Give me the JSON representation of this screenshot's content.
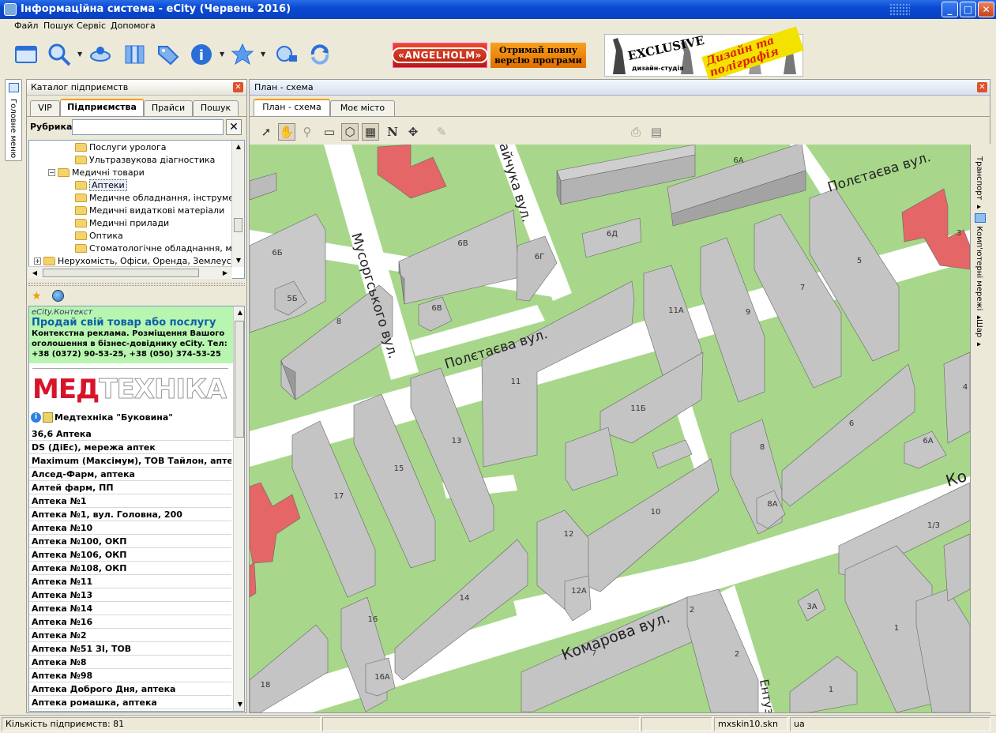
{
  "window": {
    "title": "Інформаційна система - eCity (Червень 2016)",
    "min": "_",
    "max": "□",
    "close": "✕"
  },
  "menu": [
    "Файл",
    "Пошук",
    "Сервіс",
    "Допомога"
  ],
  "ads": {
    "angelholm": "«ANGELHOLM»",
    "full_version_line1": "Отримай повну",
    "full_version_line2": "версію програми",
    "exclusive": "EXCLUSIVE",
    "exclusive_sub": "дизайн-студія",
    "design": "Дизайн та поліграфія"
  },
  "sidetab": "Головне меню",
  "catalog": {
    "title": "Каталог підприємств",
    "tabs": [
      "VIP",
      "Підприємства",
      "Прайси",
      "Пошук"
    ],
    "rubric_label": "Рубрика",
    "rubric_value": "",
    "clear": "✕",
    "tree": [
      {
        "label": "Послуги уролога",
        "level": 3
      },
      {
        "label": "Ультразвукова діагностика",
        "level": 3
      },
      {
        "label": "Медичні товари",
        "level": 2,
        "expander": "−"
      },
      {
        "label": "Аптеки",
        "level": 3,
        "selected": true
      },
      {
        "label": "Медичне обладнання, інструмент",
        "level": 3
      },
      {
        "label": "Медичні видаткові матеріали",
        "level": 3
      },
      {
        "label": "Медичні прилади",
        "level": 3
      },
      {
        "label": "Оптика",
        "level": 3
      },
      {
        "label": "Стоматологічне обладнання, матер",
        "level": 3
      },
      {
        "label": "Нерухомість, Офіси, Оренда, Землеустрій",
        "level": 1,
        "expander": "+"
      }
    ],
    "context_ad": {
      "brand": "eCity.Контекст",
      "title": "Продай свій товар або послугу",
      "body": "Контекстна реклама. Розміщення Вашого оголошення в бізнес-довіднику eCity. Тел: +38 (0372) 90-53-25, +38 (050) 374-53-25"
    },
    "logo": {
      "part1": "МЕД",
      "part2": "ТЕХНІКА"
    },
    "featured": "Медтехніка \"Буковина\"",
    "companies": [
      "36,6 Аптека",
      "DS (ДіЕс), мережа аптек",
      "Maximum (Максімум), ТОВ Тайлон, аптека",
      "Алсед-Фарм, аптека",
      "Алтей фарм, ПП",
      "Аптека №1",
      "Аптека №1, вул. Головна, 200",
      "Аптека №10",
      "Аптека №100, ОКП",
      "Аптека №106, ОКП",
      "Аптека №108, ОКП",
      "Аптека №11",
      "Аптека №13",
      "Аптека №14",
      "Аптека №16",
      "Аптека №2",
      "Аптека №51 ЗІ, ТОВ",
      "Аптека №8",
      "Аптека №98",
      "Аптека Доброго Дня, аптека",
      "Аптека ромашка, аптека"
    ]
  },
  "map": {
    "title": "План - схема",
    "tabs": [
      "План - схема",
      "Моє місто"
    ],
    "streets": [
      "Мусоргського вул.",
      "Полєтаєва вул.",
      "Полєтаєва вул.",
      "Комарова вул.",
      "айчука вул.",
      "Ко",
      "Ентуз"
    ],
    "buildings": [
      "6А",
      "6В",
      "6Б",
      "5Б",
      "6Д",
      "6Г",
      "6В",
      "8",
      "11А",
      "9",
      "7",
      "5",
      "3",
      "11",
      "11Б",
      "13",
      "15",
      "17",
      "8",
      "6",
      "6А",
      "4",
      "12",
      "12А",
      "10",
      "8А",
      "1/3",
      "14",
      "16",
      "16А",
      "18",
      "3А",
      "1",
      "7",
      "2",
      "2",
      "1"
    ],
    "right_panel": [
      "Транспорт ▸",
      "Комп'ютерні мережі ▸",
      "Шар ▸"
    ]
  },
  "status": {
    "count": "Кількість підприємств: 81",
    "skin": "mxskin10.skn",
    "lang": "ua"
  }
}
